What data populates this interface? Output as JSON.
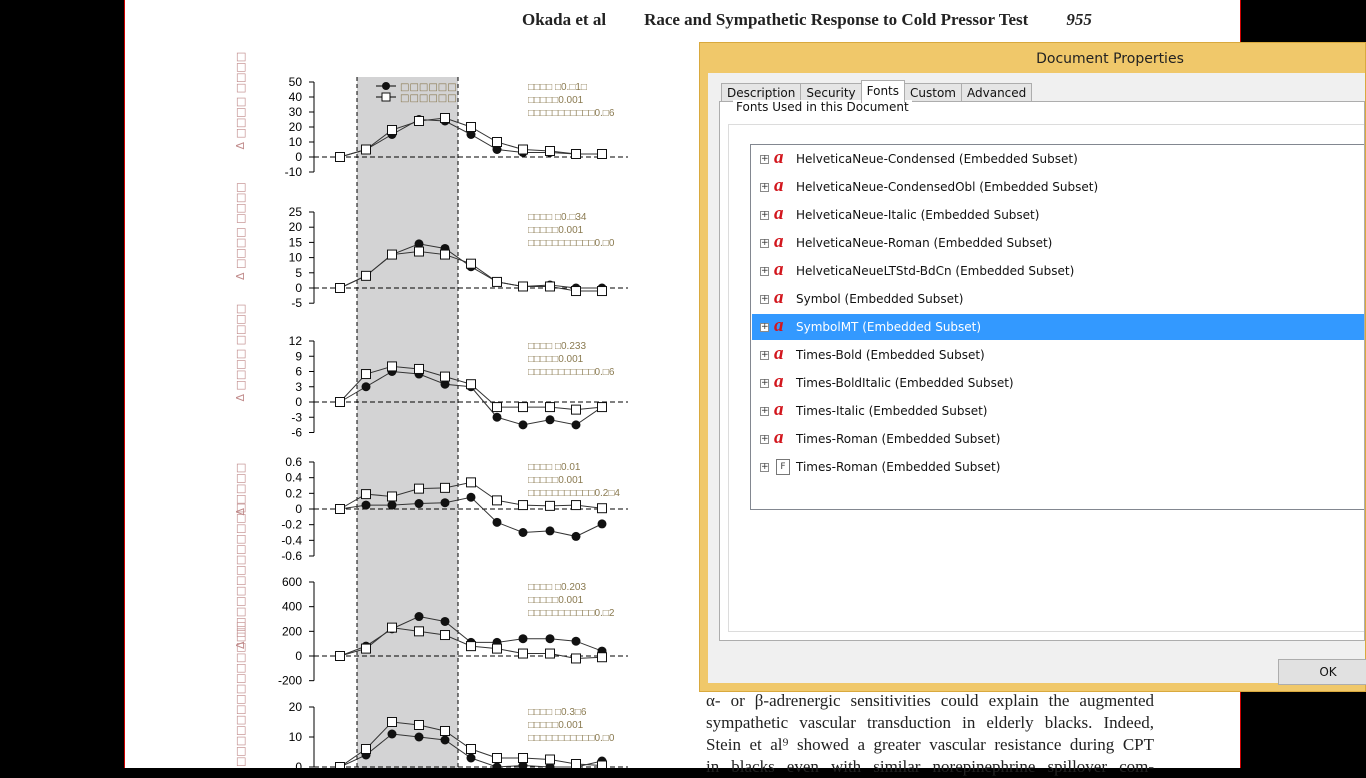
{
  "document": {
    "header": {
      "authors": "Okada et al",
      "title": "Race and Sympathetic Response to Cold Pressor Test",
      "page": "955"
    },
    "body_lines": [
      "α- or β-adrenergic sensitivities could explain the augmented",
      "sympathetic vascular transduction in elderly blacks. Indeed,",
      "Stein et al⁹ showed a greater vascular resistance during CPT",
      "in blacks even with similar norepinephrine spillover com-"
    ],
    "legend": [
      "□□□□□□",
      "□□□□□□"
    ]
  },
  "chart_data": [
    {
      "type": "line",
      "ylabel": "Δ □□□□ □□□□",
      "ylim": [
        -10,
        50
      ],
      "yticks": [
        -10,
        0,
        10,
        20,
        30,
        40,
        50
      ],
      "stats": [
        "□□□□ □0.□1□",
        "□□□□□0.001",
        "□□□□□□□□□□□0.□6"
      ],
      "series": [
        {
          "marker": "filled-circle",
          "values": [
            0,
            5,
            15,
            25,
            24,
            15,
            5,
            3,
            3,
            2,
            2
          ]
        },
        {
          "marker": "open-square",
          "values": [
            0,
            5,
            18,
            24,
            26,
            20,
            10,
            5,
            4,
            2,
            2
          ]
        }
      ]
    },
    {
      "type": "line",
      "ylabel": "Δ □□□□ □□□□",
      "ylim": [
        -5,
        25
      ],
      "yticks": [
        -5,
        0,
        5,
        10,
        15,
        20,
        25
      ],
      "stats": [
        "□□□□ □0.□34",
        "□□□□□0.001",
        "□□□□□□□□□□□0.□0"
      ],
      "series": [
        {
          "marker": "filled-circle",
          "values": [
            0,
            4,
            11,
            14.5,
            13,
            7,
            2,
            0.5,
            1,
            0,
            0
          ]
        },
        {
          "marker": "open-square",
          "values": [
            0,
            4,
            11,
            12,
            11,
            8,
            2,
            0.5,
            0.5,
            -1,
            -1
          ]
        }
      ]
    },
    {
      "type": "line",
      "ylabel": "Δ □□□□ □□□□",
      "ylim": [
        -6,
        12
      ],
      "yticks": [
        -6,
        -3,
        0,
        3,
        6,
        9,
        12
      ],
      "stats": [
        "□□□□ □0.233",
        "□□□□□0.001",
        "□□□□□□□□□□□0.□6"
      ],
      "series": [
        {
          "marker": "filled-circle",
          "values": [
            0,
            3,
            6,
            5.5,
            3.5,
            3,
            -3,
            -4.5,
            -3.5,
            -4.5,
            -1
          ]
        },
        {
          "marker": "open-square",
          "values": [
            0,
            5.5,
            7,
            6.5,
            5,
            3.5,
            -1,
            -1,
            -1,
            -1.5,
            -1
          ]
        }
      ]
    },
    {
      "type": "line",
      "ylabel": "Δ □□□□",
      "ylim": [
        -0.6,
        0.6
      ],
      "yticks": [
        -0.6,
        -0.4,
        -0.2,
        0,
        0.2,
        0.4,
        0.6
      ],
      "stats": [
        "□□□□ □0.01",
        "□□□□□0.001",
        "□□□□□□□□□□□0.2□4"
      ],
      "series": [
        {
          "marker": "filled-circle",
          "values": [
            0,
            0.05,
            0.05,
            0.07,
            0.08,
            0.15,
            -0.17,
            -0.3,
            -0.28,
            -0.35,
            -0.19
          ]
        },
        {
          "marker": "open-square",
          "values": [
            0,
            0.19,
            0.16,
            0.26,
            0.27,
            0.34,
            0.11,
            0.05,
            0.04,
            0.05,
            0.01
          ]
        }
      ]
    },
    {
      "type": "line",
      "ylabel": "Δ □□□□□□□□□□□□□",
      "ylim": [
        -200,
        600
      ],
      "yticks": [
        -200,
        0,
        200,
        400,
        600
      ],
      "stats": [
        "□□□□ □0.203",
        "□□□□□0.001",
        "□□□□□□□□□□□0.□2"
      ],
      "series": [
        {
          "marker": "filled-circle",
          "values": [
            0,
            80,
            220,
            320,
            280,
            110,
            110,
            140,
            140,
            120,
            40
          ]
        },
        {
          "marker": "open-square",
          "values": [
            0,
            60,
            230,
            200,
            170,
            80,
            60,
            20,
            20,
            -20,
            -10
          ]
        }
      ]
    },
    {
      "type": "line",
      "ylabel": "□□□□□□□□□□□□□□",
      "ylim": [
        0,
        20
      ],
      "yticks": [
        0,
        10,
        20
      ],
      "stats": [
        "□□□□ □0.3□6",
        "□□□□□0.001",
        "□□□□□□□□□□□0.□0"
      ],
      "series": [
        {
          "marker": "filled-circle",
          "values": [
            0,
            4,
            11,
            10,
            9,
            3,
            0,
            0.5,
            0,
            0,
            2
          ]
        },
        {
          "marker": "open-square",
          "values": [
            0,
            6,
            15,
            14,
            12,
            6,
            3,
            3,
            2.5,
            1,
            0.5
          ]
        }
      ]
    }
  ],
  "dialog": {
    "title": "Document Properties",
    "tabs": [
      "Description",
      "Security",
      "Fonts",
      "Custom",
      "Advanced"
    ],
    "active_tab": "Fonts",
    "group_label": "Fonts Used in this Document",
    "fonts": [
      {
        "name": "HelveticaNeue-Condensed (Embedded Subset)",
        "icon": "opentype-a-icon"
      },
      {
        "name": "HelveticaNeue-CondensedObl (Embedded Subset)",
        "icon": "opentype-a-icon"
      },
      {
        "name": "HelveticaNeue-Italic (Embedded Subset)",
        "icon": "opentype-a-icon"
      },
      {
        "name": "HelveticaNeue-Roman (Embedded Subset)",
        "icon": "opentype-a-icon"
      },
      {
        "name": "HelveticaNeueLTStd-BdCn (Embedded Subset)",
        "icon": "opentype-a-icon"
      },
      {
        "name": "Symbol (Embedded Subset)",
        "icon": "opentype-a-icon"
      },
      {
        "name": "SymbolMT (Embedded Subset)",
        "icon": "opentype-a-icon",
        "selected": true
      },
      {
        "name": "Times-Bold (Embedded Subset)",
        "icon": "opentype-a-icon"
      },
      {
        "name": "Times-BoldItalic (Embedded Subset)",
        "icon": "opentype-a-icon"
      },
      {
        "name": "Times-Italic (Embedded Subset)",
        "icon": "opentype-a-icon"
      },
      {
        "name": "Times-Roman (Embedded Subset)",
        "icon": "opentype-a-icon"
      },
      {
        "name": "Times-Roman (Embedded Subset)",
        "icon": "type1-f-icon"
      }
    ],
    "ok_label": "OK",
    "frame_color": "#f0c86a",
    "selection_color": "#3399ff"
  }
}
